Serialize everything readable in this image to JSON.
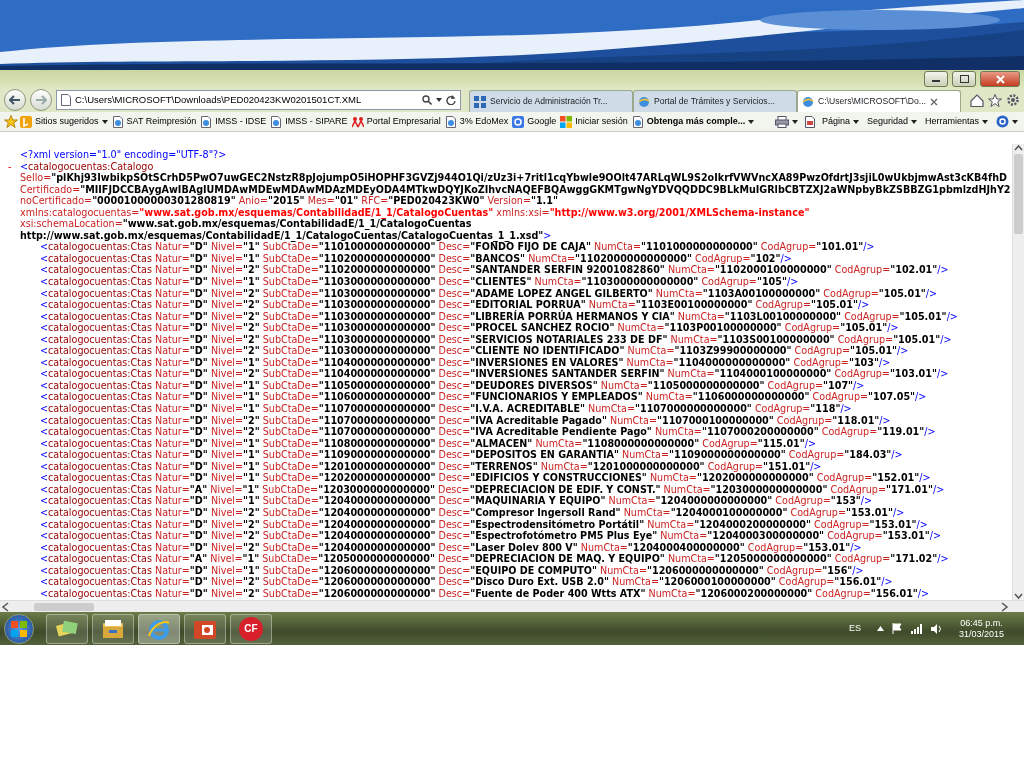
{
  "browser": {
    "address": "C:\\Users\\MICROSOFT\\Downloads\\PED020423KW0201501CT.XML",
    "tabs": [
      {
        "label": "Servicio de Administración Tr...",
        "selected": false,
        "kind": "grid"
      },
      {
        "label": "Portal de Trámites y Servicios...",
        "selected": false,
        "kind": "web"
      },
      {
        "label": "C:\\Users\\MICROSOFT\\Do...",
        "selected": true,
        "kind": "web"
      }
    ]
  },
  "favorites": [
    {
      "label": "Sitios sugeridos",
      "kind": "logo",
      "dropdown": true,
      "bold": false
    },
    {
      "label": "SAT Reimpresión",
      "kind": "web",
      "dropdown": false,
      "bold": false
    },
    {
      "label": "IMSS - IDSE",
      "kind": "web",
      "dropdown": false,
      "bold": false
    },
    {
      "label": "IMSS - SIPARE",
      "kind": "web",
      "dropdown": false,
      "bold": false
    },
    {
      "label": "Portal Empresarial",
      "kind": "people",
      "dropdown": false,
      "bold": false
    },
    {
      "label": "3% EdoMex",
      "kind": "web",
      "dropdown": false,
      "bold": false
    },
    {
      "label": "Google",
      "kind": "square",
      "dropdown": false,
      "bold": false
    },
    {
      "label": "Iniciar sesión",
      "kind": "squares",
      "dropdown": false,
      "bold": false
    },
    {
      "label": "Obtenga más comple...",
      "kind": "web",
      "dropdown": true,
      "bold": true
    }
  ],
  "commands": [
    {
      "label": "Página"
    },
    {
      "label": "Seguridad"
    },
    {
      "label": "Herramientas"
    }
  ],
  "xml": {
    "declaration": "<?xml version=\"1.0\" encoding=\"UTF-8\"?>",
    "collapse_toggle": "-",
    "root_open": "<",
    "root_tag": "catalogocuentas:Catalogo",
    "root_lines": [
      {
        "attributes": [
          {
            "name": "Sello=",
            "value": "\"plKhj93IwbikpSOtSCrhD5PwO7uwGEC2NstzR8pJojumpO5iHOPHF3GVZj944O1Qi/zUz3i+7ritl1cqYbwle9OOlt47ARLqWL9S2oIkrfVWVncXA89PwzOfdrtJ3sjiL0wUkbjmwAst3cKB4fhD",
            "kind": "plain"
          }
        ]
      },
      {
        "attributes": [
          {
            "name": "Certificado=",
            "value": "\"MIIFJDCCBAygAwIBAgIUMDAwMDEwMDAwMDAzMDEyODA4MTkwDQYJKoZIhvcNAQEFBQAwggGKMTgwNgYDVQQDDC9BLkMuIGRlbCBTZXJ2aWNpbyBkZSBBZG1pbmlzdHJhY2",
            "kind": "plain"
          }
        ]
      },
      {
        "attributes": [
          {
            "name": "noCertificado=",
            "value": "\"00001000000301280819\"",
            "kind": "plain"
          },
          {
            "name": "Anio=",
            "value": "\"2015\"",
            "kind": "plain"
          },
          {
            "name": "Mes=",
            "value": "\"01\"",
            "kind": "plain"
          },
          {
            "name": "RFC=",
            "value": "\"PED020423KW0\"",
            "kind": "plain"
          },
          {
            "name": "Version=",
            "value": "\"1.1\"",
            "kind": "plain"
          }
        ]
      },
      {
        "attributes": [
          {
            "name": "xmlns:catalogocuentas=",
            "value": "\"www.sat.gob.mx/esquemas/ContabilidadE/1_1/CatalogoCuentas\"",
            "kind": "namespace"
          },
          {
            "name": "xmlns:xsi=",
            "value": "\"http://www.w3.org/2001/XMLSchema-instance\"",
            "kind": "namespace"
          }
        ]
      },
      {
        "attributes": [
          {
            "name": "xsi:schemaLocation=",
            "value": "\"www.sat.gob.mx/esquemas/ContabilidadE/1_1/CatalogoCuentas",
            "kind": "plain"
          }
        ]
      },
      {
        "attributes": [
          {
            "value": "http://www.sat.gob.mx/esquemas/ContabilidadE/1_1/CatalogoCuentas/CatalogoCuentas_1_1.xsd\"",
            "kind": "plain"
          }
        ],
        "end": ">"
      }
    ],
    "elements": [
      {
        "open": "<",
        "tag": "catalogocuentas:Ctas",
        "attributes": [
          {
            "name": "Natur=",
            "value": "\"D\""
          },
          {
            "name": "Nivel=",
            "value": "\"1\""
          },
          {
            "name": "SubCtaDe=",
            "value": "\"1101000000000000\""
          },
          {
            "name": "Desc=",
            "value": "\"FONDO FIJO DE CAJA\""
          },
          {
            "name": "NumCta=",
            "value": "\"1101000000000000\""
          },
          {
            "name": "CodAgrup=",
            "value": "\"101.01\""
          }
        ],
        "end": "/>"
      },
      {
        "open": "<",
        "tag": "catalogocuentas:Ctas",
        "attributes": [
          {
            "name": "Natur=",
            "value": "\"D\""
          },
          {
            "name": "Nivel=",
            "value": "\"1\""
          },
          {
            "name": "SubCtaDe=",
            "value": "\"1102000000000000\""
          },
          {
            "name": "Desc=",
            "value": "\"BANCOS\""
          },
          {
            "name": "NumCta=",
            "value": "\"1102000000000000\""
          },
          {
            "name": "CodAgrup=",
            "value": "\"102\""
          }
        ],
        "end": "/>"
      },
      {
        "open": "<",
        "tag": "catalogocuentas:Ctas",
        "attributes": [
          {
            "name": "Natur=",
            "value": "\"D\""
          },
          {
            "name": "Nivel=",
            "value": "\"2\""
          },
          {
            "name": "SubCtaDe=",
            "value": "\"1102000000000000\""
          },
          {
            "name": "Desc=",
            "value": "\"SANTANDER SERFIN 92001082860\""
          },
          {
            "name": "NumCta=",
            "value": "\"1102000100000000\""
          },
          {
            "name": "CodAgrup=",
            "value": "\"102.01\""
          }
        ],
        "end": "/>"
      },
      {
        "open": "<",
        "tag": "catalogocuentas:Ctas",
        "attributes": [
          {
            "name": "Natur=",
            "value": "\"D\""
          },
          {
            "name": "Nivel=",
            "value": "\"1\""
          },
          {
            "name": "SubCtaDe=",
            "value": "\"1103000000000000\""
          },
          {
            "name": "Desc=",
            "value": "\"CLIENTES\""
          },
          {
            "name": "NumCta=",
            "value": "\"1103000000000000\""
          },
          {
            "name": "CodAgrup=",
            "value": "\"105\""
          }
        ],
        "end": "/>"
      },
      {
        "open": "<",
        "tag": "catalogocuentas:Ctas",
        "attributes": [
          {
            "name": "Natur=",
            "value": "\"D\""
          },
          {
            "name": "Nivel=",
            "value": "\"2\""
          },
          {
            "name": "SubCtaDe=",
            "value": "\"1103000000000000\""
          },
          {
            "name": "Desc=",
            "value": "\"ADAME LOPEZ ANGEL GILBERTO\""
          },
          {
            "name": "NumCta=",
            "value": "\"1103A00100000000\""
          },
          {
            "name": "CodAgrup=",
            "value": "\"105.01\""
          }
        ],
        "end": "/>"
      },
      {
        "open": "<",
        "tag": "catalogocuentas:Ctas",
        "attributes": [
          {
            "name": "Natur=",
            "value": "\"D\""
          },
          {
            "name": "Nivel=",
            "value": "\"2\""
          },
          {
            "name": "SubCtaDe=",
            "value": "\"1103000000000000\""
          },
          {
            "name": "Desc=",
            "value": "\"EDITORIAL PORRUA\""
          },
          {
            "name": "NumCta=",
            "value": "\"1103E00100000000\""
          },
          {
            "name": "CodAgrup=",
            "value": "\"105.01\""
          }
        ],
        "end": "/>"
      },
      {
        "open": "<",
        "tag": "catalogocuentas:Ctas",
        "attributes": [
          {
            "name": "Natur=",
            "value": "\"D\""
          },
          {
            "name": "Nivel=",
            "value": "\"2\""
          },
          {
            "name": "SubCtaDe=",
            "value": "\"1103000000000000\""
          },
          {
            "name": "Desc=",
            "value": "\"LIBRERÍA PORRÚA HERMANOS Y CIA\""
          },
          {
            "name": "NumCta=",
            "value": "\"1103L00100000000\""
          },
          {
            "name": "CodAgrup=",
            "value": "\"105.01\""
          }
        ],
        "end": "/>"
      },
      {
        "open": "<",
        "tag": "catalogocuentas:Ctas",
        "attributes": [
          {
            "name": "Natur=",
            "value": "\"D\""
          },
          {
            "name": "Nivel=",
            "value": "\"2\""
          },
          {
            "name": "SubCtaDe=",
            "value": "\"1103000000000000\""
          },
          {
            "name": "Desc=",
            "value": "\"PROCEL SANCHEZ ROCIO\""
          },
          {
            "name": "NumCta=",
            "value": "\"1103P00100000000\""
          },
          {
            "name": "CodAgrup=",
            "value": "\"105.01\""
          }
        ],
        "end": "/>"
      },
      {
        "open": "<",
        "tag": "catalogocuentas:Ctas",
        "attributes": [
          {
            "name": "Natur=",
            "value": "\"D\""
          },
          {
            "name": "Nivel=",
            "value": "\"2\""
          },
          {
            "name": "SubCtaDe=",
            "value": "\"1103000000000000\""
          },
          {
            "name": "Desc=",
            "value": "\"SERVICIOS NOTARIALES 233 DE DF\""
          },
          {
            "name": "NumCta=",
            "value": "\"1103S00100000000\""
          },
          {
            "name": "CodAgrup=",
            "value": "\"105.01\""
          }
        ],
        "end": "/>"
      },
      {
        "open": "<",
        "tag": "catalogocuentas:Ctas",
        "attributes": [
          {
            "name": "Natur=",
            "value": "\"D\""
          },
          {
            "name": "Nivel=",
            "value": "\"2\""
          },
          {
            "name": "SubCtaDe=",
            "value": "\"1103000000000000\""
          },
          {
            "name": "Desc=",
            "value": "\"CLIENTE NO IDENTIFICADO\""
          },
          {
            "name": "NumCta=",
            "value": "\"1103Z99900000000\""
          },
          {
            "name": "CodAgrup=",
            "value": "\"105.01\""
          }
        ],
        "end": "/>"
      },
      {
        "open": "<",
        "tag": "catalogocuentas:Ctas",
        "attributes": [
          {
            "name": "Natur=",
            "value": "\"D\""
          },
          {
            "name": "Nivel=",
            "value": "\"1\""
          },
          {
            "name": "SubCtaDe=",
            "value": "\"1104000000000000\""
          },
          {
            "name": "Desc=",
            "value": "\"INVERSIONES EN VALORES\""
          },
          {
            "name": "NumCta=",
            "value": "\"1104000000000000\""
          },
          {
            "name": "CodAgrup=",
            "value": "\"103\""
          }
        ],
        "end": "/>"
      },
      {
        "open": "<",
        "tag": "catalogocuentas:Ctas",
        "attributes": [
          {
            "name": "Natur=",
            "value": "\"D\""
          },
          {
            "name": "Nivel=",
            "value": "\"2\""
          },
          {
            "name": "SubCtaDe=",
            "value": "\"1104000000000000\""
          },
          {
            "name": "Desc=",
            "value": "\"INVERSIONES SANTANDER SERFIN\""
          },
          {
            "name": "NumCta=",
            "value": "\"1104000100000000\""
          },
          {
            "name": "CodAgrup=",
            "value": "\"103.01\""
          }
        ],
        "end": "/>"
      },
      {
        "open": "<",
        "tag": "catalogocuentas:Ctas",
        "attributes": [
          {
            "name": "Natur=",
            "value": "\"D\""
          },
          {
            "name": "Nivel=",
            "value": "\"1\""
          },
          {
            "name": "SubCtaDe=",
            "value": "\"1105000000000000\""
          },
          {
            "name": "Desc=",
            "value": "\"DEUDORES DIVERSOS\""
          },
          {
            "name": "NumCta=",
            "value": "\"1105000000000000\""
          },
          {
            "name": "CodAgrup=",
            "value": "\"107\""
          }
        ],
        "end": "/>"
      },
      {
        "open": "<",
        "tag": "catalogocuentas:Ctas",
        "attributes": [
          {
            "name": "Natur=",
            "value": "\"D\""
          },
          {
            "name": "Nivel=",
            "value": "\"1\""
          },
          {
            "name": "SubCtaDe=",
            "value": "\"1106000000000000\""
          },
          {
            "name": "Desc=",
            "value": "\"FUNCIONARIOS Y EMPLEADOS\""
          },
          {
            "name": "NumCta=",
            "value": "\"1106000000000000\""
          },
          {
            "name": "CodAgrup=",
            "value": "\"107.05\""
          }
        ],
        "end": "/>"
      },
      {
        "open": "<",
        "tag": "catalogocuentas:Ctas",
        "attributes": [
          {
            "name": "Natur=",
            "value": "\"D\""
          },
          {
            "name": "Nivel=",
            "value": "\"1\""
          },
          {
            "name": "SubCtaDe=",
            "value": "\"1107000000000000\""
          },
          {
            "name": "Desc=",
            "value": "\"I.V.A. ACREDITABLE\""
          },
          {
            "name": "NumCta=",
            "value": "\"1107000000000000\""
          },
          {
            "name": "CodAgrup=",
            "value": "\"118\""
          }
        ],
        "end": "/>"
      },
      {
        "open": "<",
        "tag": "catalogocuentas:Ctas",
        "attributes": [
          {
            "name": "Natur=",
            "value": "\"D\""
          },
          {
            "name": "Nivel=",
            "value": "\"2\""
          },
          {
            "name": "SubCtaDe=",
            "value": "\"1107000000000000\""
          },
          {
            "name": "Desc=",
            "value": "\"IVA Acreditable Pagado\""
          },
          {
            "name": "NumCta=",
            "value": "\"1107000100000000\""
          },
          {
            "name": "CodAgrup=",
            "value": "\"118.01\""
          }
        ],
        "end": "/>"
      },
      {
        "open": "<",
        "tag": "catalogocuentas:Ctas",
        "attributes": [
          {
            "name": "Natur=",
            "value": "\"D\""
          },
          {
            "name": "Nivel=",
            "value": "\"2\""
          },
          {
            "name": "SubCtaDe=",
            "value": "\"1107000000000000\""
          },
          {
            "name": "Desc=",
            "value": "\"IVA Acreditable Pendiente Pago\""
          },
          {
            "name": "NumCta=",
            "value": "\"1107000200000000\""
          },
          {
            "name": "CodAgrup=",
            "value": "\"119.01\""
          }
        ],
        "end": "/>"
      },
      {
        "open": "<",
        "tag": "catalogocuentas:Ctas",
        "attributes": [
          {
            "name": "Natur=",
            "value": "\"D\""
          },
          {
            "name": "Nivel=",
            "value": "\"1\""
          },
          {
            "name": "SubCtaDe=",
            "value": "\"1108000000000000\""
          },
          {
            "name": "Desc=",
            "value": "\"ALMACEN\""
          },
          {
            "name": "NumCta=",
            "value": "\"1108000000000000\""
          },
          {
            "name": "CodAgrup=",
            "value": "\"115.01\""
          }
        ],
        "end": "/>"
      },
      {
        "open": "<",
        "tag": "catalogocuentas:Ctas",
        "attributes": [
          {
            "name": "Natur=",
            "value": "\"D\""
          },
          {
            "name": "Nivel=",
            "value": "\"1\""
          },
          {
            "name": "SubCtaDe=",
            "value": "\"1109000000000000\""
          },
          {
            "name": "Desc=",
            "value": "\"DEPOSITOS EN GARANTIA\""
          },
          {
            "name": "NumCta=",
            "value": "\"1109000000000000\""
          },
          {
            "name": "CodAgrup=",
            "value": "\"184.03\""
          }
        ],
        "end": "/>"
      },
      {
        "open": "<",
        "tag": "catalogocuentas:Ctas",
        "attributes": [
          {
            "name": "Natur=",
            "value": "\"D\""
          },
          {
            "name": "Nivel=",
            "value": "\"1\""
          },
          {
            "name": "SubCtaDe=",
            "value": "\"1201000000000000\""
          },
          {
            "name": "Desc=",
            "value": "\"TERRENOS\""
          },
          {
            "name": "NumCta=",
            "value": "\"1201000000000000\""
          },
          {
            "name": "CodAgrup=",
            "value": "\"151.01\""
          }
        ],
        "end": "/>"
      },
      {
        "open": "<",
        "tag": "catalogocuentas:Ctas",
        "attributes": [
          {
            "name": "Natur=",
            "value": "\"D\""
          },
          {
            "name": "Nivel=",
            "value": "\"1\""
          },
          {
            "name": "SubCtaDe=",
            "value": "\"1202000000000000\""
          },
          {
            "name": "Desc=",
            "value": "\"EDIFICIOS Y CONSTRUCCIONES\""
          },
          {
            "name": "NumCta=",
            "value": "\"1202000000000000\""
          },
          {
            "name": "CodAgrup=",
            "value": "\"152.01\""
          }
        ],
        "end": "/>"
      },
      {
        "open": "<",
        "tag": "catalogocuentas:Ctas",
        "attributes": [
          {
            "name": "Natur=",
            "value": "\"A\""
          },
          {
            "name": "Nivel=",
            "value": "\"1\""
          },
          {
            "name": "SubCtaDe=",
            "value": "\"1203000000000000\""
          },
          {
            "name": "Desc=",
            "value": "\"DEPRECIACION DE EDIF. Y CONST.\""
          },
          {
            "name": "NumCta=",
            "value": "\"1203000000000000\""
          },
          {
            "name": "CodAgrup=",
            "value": "\"171.01\""
          }
        ],
        "end": "/>"
      },
      {
        "open": "<",
        "tag": "catalogocuentas:Ctas",
        "attributes": [
          {
            "name": "Natur=",
            "value": "\"D\""
          },
          {
            "name": "Nivel=",
            "value": "\"1\""
          },
          {
            "name": "SubCtaDe=",
            "value": "\"1204000000000000\""
          },
          {
            "name": "Desc=",
            "value": "\"MAQUINARIA Y EQUIPO\""
          },
          {
            "name": "NumCta=",
            "value": "\"1204000000000000\""
          },
          {
            "name": "CodAgrup=",
            "value": "\"153\""
          }
        ],
        "end": "/>"
      },
      {
        "open": "<",
        "tag": "catalogocuentas:Ctas",
        "attributes": [
          {
            "name": "Natur=",
            "value": "\"D\""
          },
          {
            "name": "Nivel=",
            "value": "\"2\""
          },
          {
            "name": "SubCtaDe=",
            "value": "\"1204000000000000\""
          },
          {
            "name": "Desc=",
            "value": "\"Compresor Ingersoll Rand\""
          },
          {
            "name": "NumCta=",
            "value": "\"1204000100000000\""
          },
          {
            "name": "CodAgrup=",
            "value": "\"153.01\""
          }
        ],
        "end": "/>"
      },
      {
        "open": "<",
        "tag": "catalogocuentas:Ctas",
        "attributes": [
          {
            "name": "Natur=",
            "value": "\"D\""
          },
          {
            "name": "Nivel=",
            "value": "\"2\""
          },
          {
            "name": "SubCtaDe=",
            "value": "\"1204000000000000\""
          },
          {
            "name": "Desc=",
            "value": "\"Espectrodensitómetro Portátil\""
          },
          {
            "name": "NumCta=",
            "value": "\"1204000200000000\""
          },
          {
            "name": "CodAgrup=",
            "value": "\"153.01\""
          }
        ],
        "end": "/>"
      },
      {
        "open": "<",
        "tag": "catalogocuentas:Ctas",
        "attributes": [
          {
            "name": "Natur=",
            "value": "\"D\""
          },
          {
            "name": "Nivel=",
            "value": "\"2\""
          },
          {
            "name": "SubCtaDe=",
            "value": "\"1204000000000000\""
          },
          {
            "name": "Desc=",
            "value": "\"Espectrofotómetro PM5 Plus Eye\""
          },
          {
            "name": "NumCta=",
            "value": "\"1204000300000000\""
          },
          {
            "name": "CodAgrup=",
            "value": "\"153.01\""
          }
        ],
        "end": "/>"
      },
      {
        "open": "<",
        "tag": "catalogocuentas:Ctas",
        "attributes": [
          {
            "name": "Natur=",
            "value": "\"D\""
          },
          {
            "name": "Nivel=",
            "value": "\"2\""
          },
          {
            "name": "SubCtaDe=",
            "value": "\"1204000000000000\""
          },
          {
            "name": "Desc=",
            "value": "\"Laser Dolev 800 V\""
          },
          {
            "name": "NumCta=",
            "value": "\"1204000400000000\""
          },
          {
            "name": "CodAgrup=",
            "value": "\"153.01\""
          }
        ],
        "end": "/>"
      },
      {
        "open": "<",
        "tag": "catalogocuentas:Ctas",
        "attributes": [
          {
            "name": "Natur=",
            "value": "\"A\""
          },
          {
            "name": "Nivel=",
            "value": "\"1\""
          },
          {
            "name": "SubCtaDe=",
            "value": "\"1205000000000000\""
          },
          {
            "name": "Desc=",
            "value": "\"DEPRECIACION DE MAQ. Y EQUIPO\""
          },
          {
            "name": "NumCta=",
            "value": "\"1205000000000000\""
          },
          {
            "name": "CodAgrup=",
            "value": "\"171.02\""
          }
        ],
        "end": "/>"
      },
      {
        "open": "<",
        "tag": "catalogocuentas:Ctas",
        "attributes": [
          {
            "name": "Natur=",
            "value": "\"D\""
          },
          {
            "name": "Nivel=",
            "value": "\"1\""
          },
          {
            "name": "SubCtaDe=",
            "value": "\"1206000000000000\""
          },
          {
            "name": "Desc=",
            "value": "\"EQUIPO DE COMPUTO\""
          },
          {
            "name": "NumCta=",
            "value": "\"1206000000000000\""
          },
          {
            "name": "CodAgrup=",
            "value": "\"156\""
          }
        ],
        "end": "/>"
      },
      {
        "open": "<",
        "tag": "catalogocuentas:Ctas",
        "attributes": [
          {
            "name": "Natur=",
            "value": "\"D\""
          },
          {
            "name": "Nivel=",
            "value": "\"2\""
          },
          {
            "name": "SubCtaDe=",
            "value": "\"1206000000000000\""
          },
          {
            "name": "Desc=",
            "value": "\"Disco Duro Ext. USB 2.0\""
          },
          {
            "name": "NumCta=",
            "value": "\"1206000100000000\""
          },
          {
            "name": "CodAgrup=",
            "value": "\"156.01\""
          }
        ],
        "end": "/>"
      },
      {
        "open": "<",
        "tag": "catalogocuentas:Ctas",
        "attributes": [
          {
            "name": "Natur=",
            "value": "\"D\""
          },
          {
            "name": "Nivel=",
            "value": "\"2\""
          },
          {
            "name": "SubCtaDe=",
            "value": "\"1206000000000000\""
          },
          {
            "name": "Desc=",
            "value": "\"Fuente de Poder 400 Wtts ATX\""
          },
          {
            "name": "NumCta=",
            "value": "\"1206000200000000\""
          },
          {
            "name": "CodAgrup=",
            "value": "\"156.01\""
          }
        ],
        "end": "/>"
      }
    ]
  },
  "taskbar": {
    "apps": [
      {
        "kind": "notes",
        "active": false
      },
      {
        "kind": "folder",
        "active": false
      },
      {
        "kind": "ie",
        "active": true
      },
      {
        "kind": "slides",
        "active": false
      },
      {
        "kind": "cf",
        "label": "CF",
        "active": false
      }
    ],
    "language": "ES",
    "time": "06:45 p.m.",
    "date": "31/03/2015"
  }
}
